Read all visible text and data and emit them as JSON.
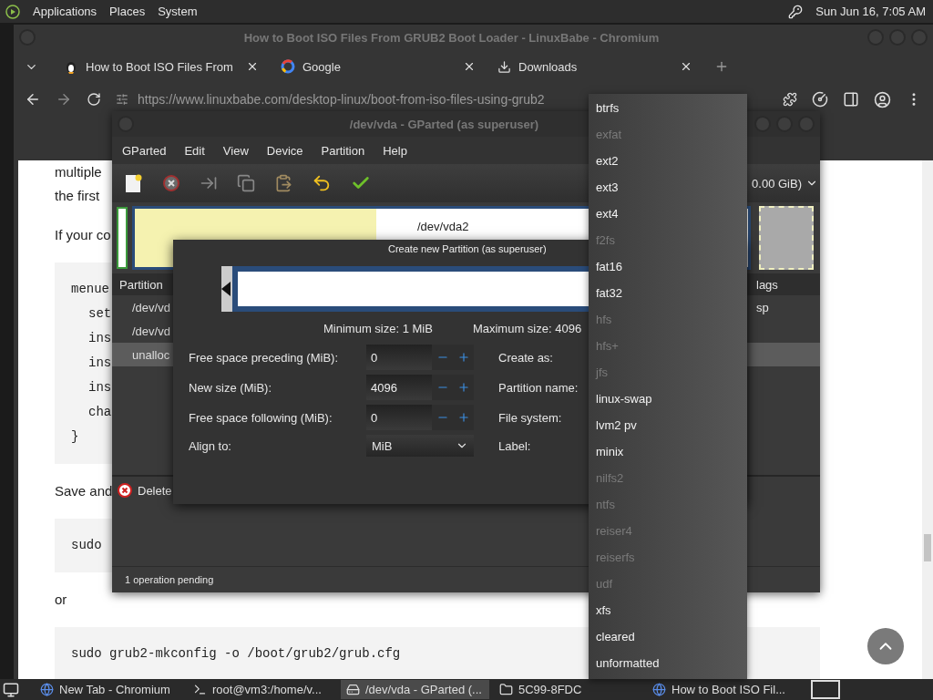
{
  "top_panel": {
    "menus": [
      "Applications",
      "Places",
      "System"
    ],
    "clock": "Sun Jun 16, 7:05 AM"
  },
  "browser": {
    "title": "How to Boot ISO Files From GRUB2 Boot Loader - LinuxBabe - Chromium",
    "tabs": [
      {
        "label": "How to Boot ISO Files From"
      },
      {
        "label": "Google"
      },
      {
        "label": "Downloads"
      }
    ],
    "url": "https://www.linuxbabe.com/desktop-linux/boot-from-iso-files-using-grub2",
    "page": [
      {
        "kind": "para",
        "lines": [
          "multiple",
          "the first"
        ]
      },
      {
        "kind": "para",
        "lines": [
          "If your co"
        ]
      },
      {
        "kind": "code",
        "lines": [
          {
            "text": "menue",
            "children": [
              {
                "text": "set"
              },
              {
                "text": "ins"
              },
              {
                "text": "ins"
              },
              {
                "text": "ins"
              },
              {
                "text": "cha"
              }
            ]
          },
          {
            "text": "}"
          }
        ]
      },
      {
        "kind": "para",
        "lines": [
          "Save and"
        ]
      },
      {
        "kind": "code",
        "lines": [
          {
            "text": "sudo"
          }
        ]
      },
      {
        "kind": "para",
        "lines": [
          "or"
        ]
      },
      {
        "kind": "code",
        "lines": [
          {
            "text": "sudo grub2-mkconfig -o /boot/grub2/grub.cfg"
          }
        ]
      }
    ]
  },
  "gparted": {
    "title": "/dev/vda - GParted (as superuser)",
    "menus": [
      "GParted",
      "Edit",
      "View",
      "Device",
      "Partition",
      "Help"
    ],
    "device": "0.00 GiB)",
    "graph_label": "/dev/vda2",
    "columns": [
      "Partition",
      "lags"
    ],
    "rows": [
      {
        "partition": "/dev/vd",
        "flags": "sp",
        "selected": false
      },
      {
        "partition": "/dev/vd",
        "selected": false
      },
      {
        "partition": "unalloc",
        "selected": true
      }
    ],
    "pending": "Delete",
    "status": "1 operation pending"
  },
  "dialog": {
    "title": "Create new Partition (as superuser)",
    "min_size": "Minimum size: 1 MiB",
    "max_size": "Maximum size: 4096",
    "fields": [
      {
        "label": "Free space preceding (MiB):",
        "value": "0"
      },
      {
        "label": "New size (MiB):",
        "value": "4096"
      },
      {
        "label": "Free space following (MiB):",
        "value": "0"
      }
    ],
    "align": {
      "label": "Align to:",
      "value": "MiB"
    },
    "right_labels": [
      "Create as:",
      "Partition name:",
      "File system:",
      "Label:"
    ]
  },
  "fs_menu": [
    {
      "label": "btrfs",
      "disabled": false
    },
    {
      "label": "exfat",
      "disabled": true
    },
    {
      "label": "ext2",
      "disabled": false
    },
    {
      "label": "ext3",
      "disabled": false
    },
    {
      "label": "ext4",
      "disabled": false
    },
    {
      "label": "f2fs",
      "disabled": true
    },
    {
      "label": "fat16",
      "disabled": false
    },
    {
      "label": "fat32",
      "disabled": false
    },
    {
      "label": "hfs",
      "disabled": true
    },
    {
      "label": "hfs+",
      "disabled": true
    },
    {
      "label": "jfs",
      "disabled": true
    },
    {
      "label": "linux-swap",
      "disabled": false
    },
    {
      "label": "lvm2 pv",
      "disabled": false
    },
    {
      "label": "minix",
      "disabled": false
    },
    {
      "label": "nilfs2",
      "disabled": true
    },
    {
      "label": "ntfs",
      "disabled": true
    },
    {
      "label": "reiser4",
      "disabled": true
    },
    {
      "label": "reiserfs",
      "disabled": true
    },
    {
      "label": "udf",
      "disabled": true
    },
    {
      "label": "xfs",
      "disabled": false
    },
    {
      "label": "cleared",
      "disabled": false
    },
    {
      "label": "unformatted",
      "disabled": false
    }
  ],
  "taskbar": [
    {
      "label": "New Tab - Chromium",
      "selected": false
    },
    {
      "label": "root@vm3:/home/v...",
      "selected": false
    },
    {
      "label": "/dev/vda - GParted (...",
      "selected": true
    },
    {
      "label": "5C99-8FDC",
      "selected": false
    },
    {
      "label": "How to Boot ISO Fil...",
      "selected": false
    }
  ]
}
